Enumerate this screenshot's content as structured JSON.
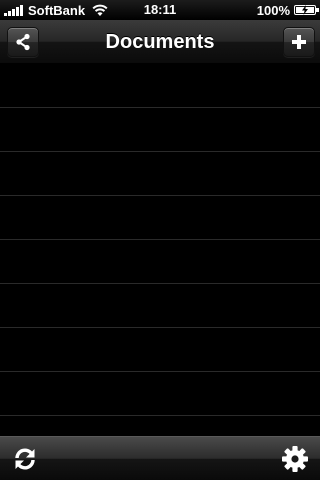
{
  "status_bar": {
    "carrier": "SoftBank",
    "time": "18:11",
    "battery": "100%"
  },
  "nav": {
    "title": "Documents",
    "left_icon": "share-icon",
    "right_icon": "plus-icon"
  },
  "list": {
    "rows": [
      "",
      "",
      "",
      "",
      "",
      "",
      "",
      "",
      ""
    ]
  },
  "toolbar": {
    "left_icon": "refresh-icon",
    "right_icon": "gear-icon"
  }
}
